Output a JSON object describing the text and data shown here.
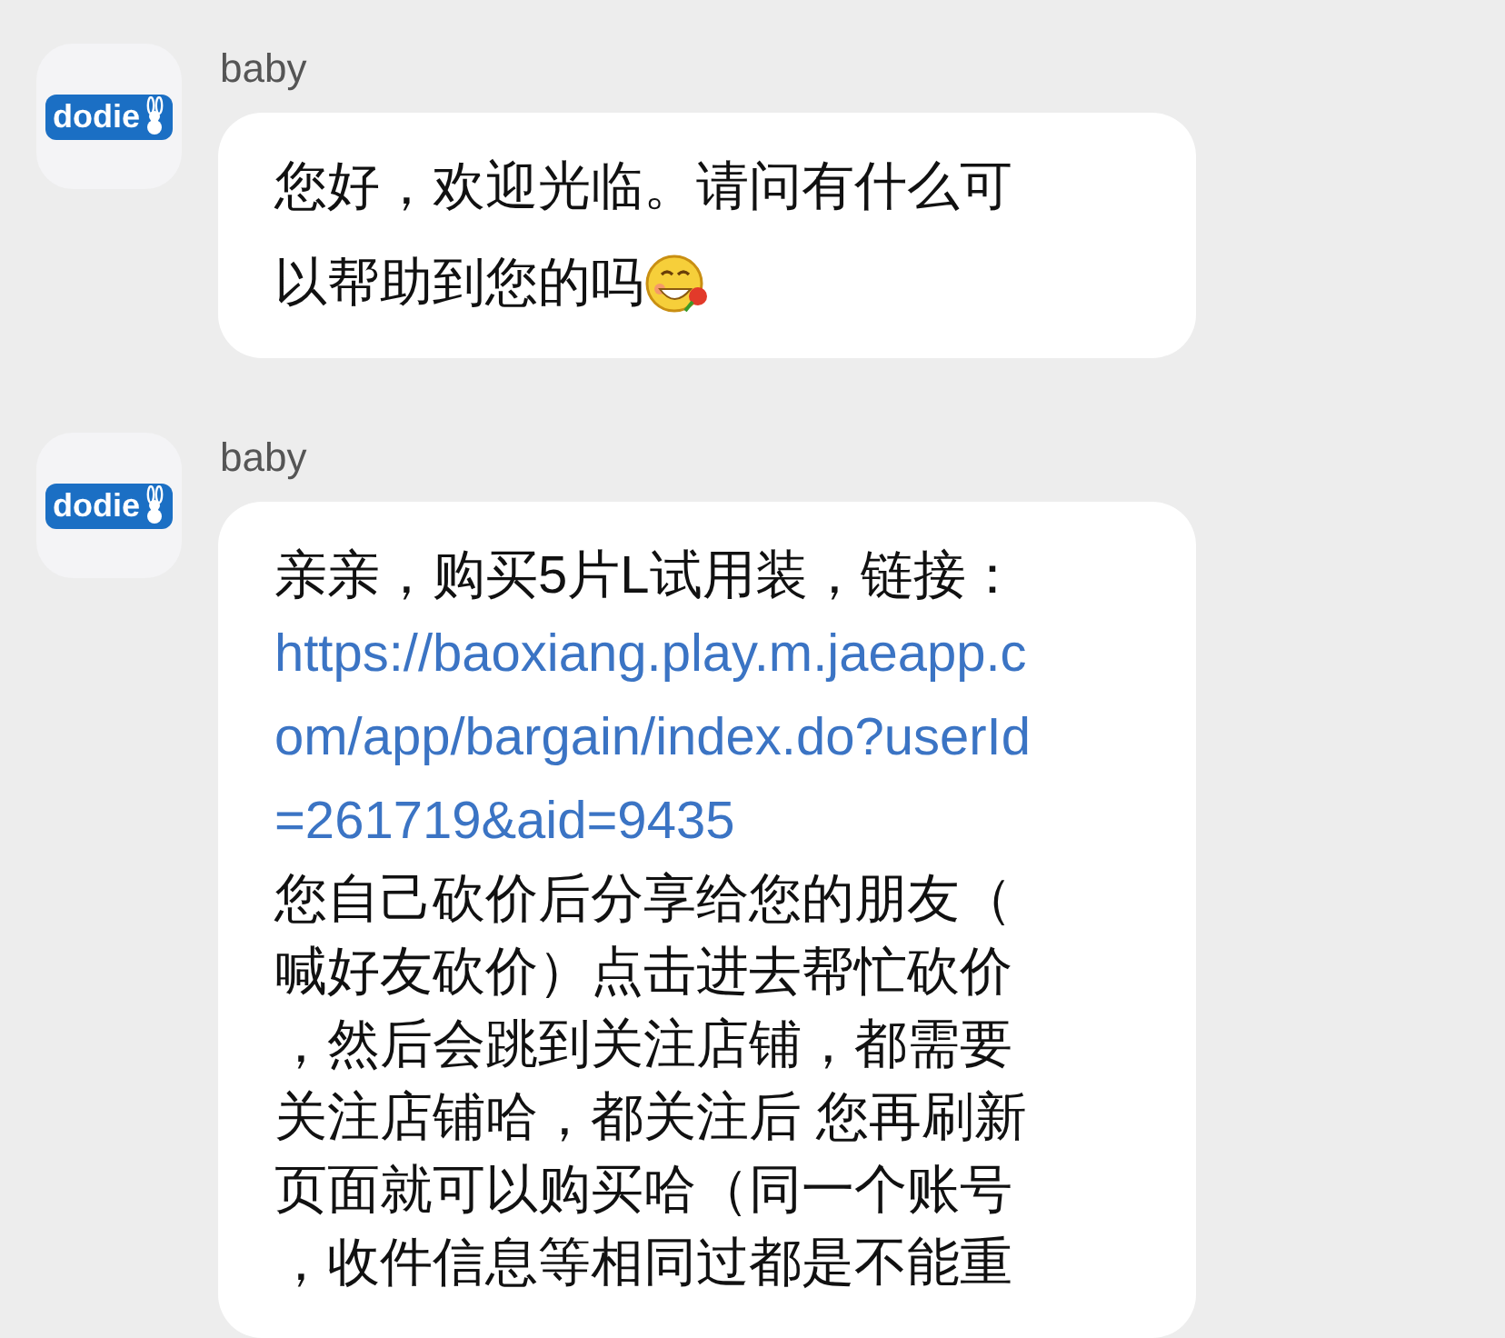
{
  "messages": [
    {
      "avatar": {
        "logo_text": "dodie"
      },
      "sender": "baby",
      "lines": [
        {
          "kind": "text",
          "text": "您好，欢迎光临。请问有什么可"
        },
        {
          "kind": "text",
          "text": "以帮助到您的吗",
          "emoji": true
        }
      ]
    },
    {
      "avatar": {
        "logo_text": "dodie"
      },
      "sender": "baby",
      "lines": [
        {
          "kind": "text",
          "text": "亲亲，购买5片L试用装，链接："
        },
        {
          "kind": "link",
          "text": "https://baoxiang.play.m.jaeapp.c"
        },
        {
          "kind": "link",
          "text": "om/app/bargain/index.do?userId"
        },
        {
          "kind": "link",
          "text": "=261719&aid=9435"
        },
        {
          "kind": "text",
          "text": "您自己砍价后分享给您的朋友（"
        },
        {
          "kind": "text",
          "text": "喊好友砍价）点击进去帮忙砍价"
        },
        {
          "kind": "text",
          "text": "，然后会跳到关注店铺，都需要"
        },
        {
          "kind": "text",
          "text": "关注店铺哈，都关注后 您再刷新"
        },
        {
          "kind": "text",
          "text": "页面就可以购买哈（同一个账号"
        },
        {
          "kind": "text",
          "text": "，收件信息等相同过都是不能重"
        }
      ]
    }
  ]
}
